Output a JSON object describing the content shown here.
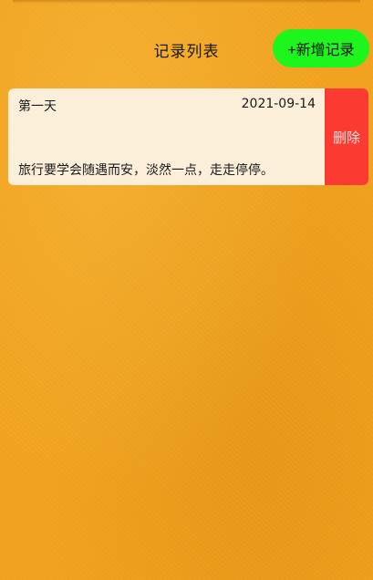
{
  "header": {
    "title": "记录列表",
    "add_label": "+新增记录"
  },
  "records": [
    {
      "title": "第一天",
      "date": "2021-09-14",
      "content": "旅行要学会随遇而安，淡然一点，走走停停。",
      "delete_label": "删除"
    }
  ],
  "colors": {
    "background": "#f0a11d",
    "add_button": "#1df51d",
    "card": "#fbefd9",
    "delete": "#fb3a32"
  }
}
